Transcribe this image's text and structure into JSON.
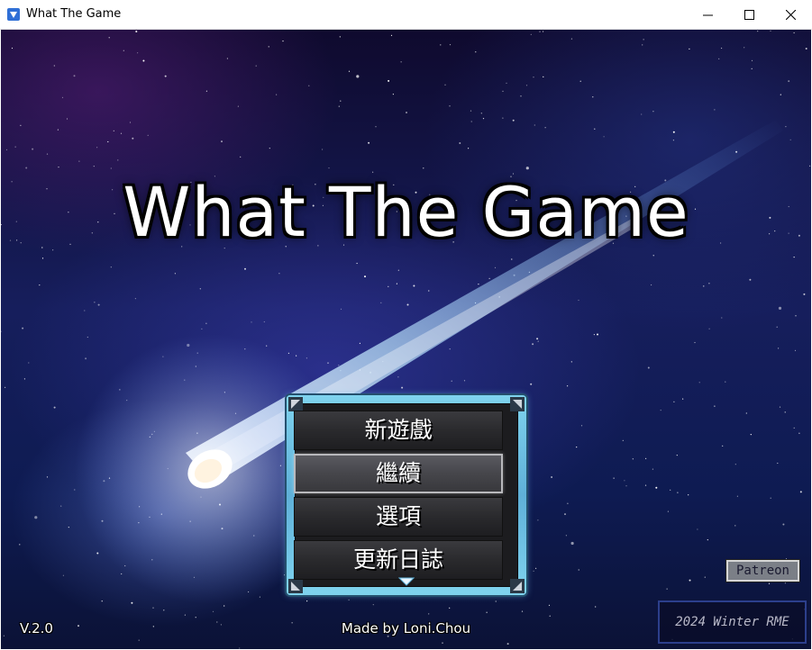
{
  "window": {
    "title": "What The Game",
    "icon": "rpg-maker-app-icon",
    "controls": {
      "minimize": "minimize-icon",
      "maximize": "maximize-icon",
      "close": "close-icon"
    }
  },
  "game": {
    "title": "What The Game",
    "menu": {
      "items": [
        {
          "label": "新遊戲",
          "selected": false
        },
        {
          "label": "繼續",
          "selected": true
        },
        {
          "label": "選項",
          "selected": false
        },
        {
          "label": "更新日誌",
          "selected": false
        }
      ],
      "scroll_indicator": "chevron-down-icon"
    },
    "version": "V.2.0",
    "credit": "Made by Loni.Chou",
    "patreon_label": "Patreon",
    "event_badge": "2024 Winter RME"
  },
  "colors": {
    "menu_frame": "#7fd3ee",
    "menu_background": "#1c1c1f",
    "sky_top": "#0f0a2e",
    "sky_bottom": "#0b1236",
    "title_text": "#ffffff"
  }
}
